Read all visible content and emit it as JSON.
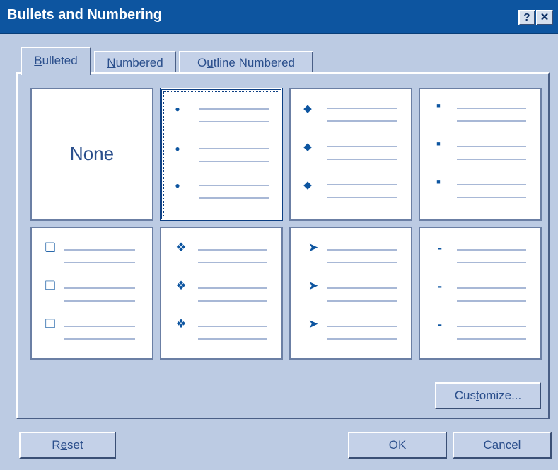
{
  "dialog": {
    "title": "Bullets and Numbering",
    "help_glyph": "?",
    "close_glyph": "✕"
  },
  "tabs": [
    {
      "label": "Bulleted",
      "accesskey": "B",
      "rest": "ulleted",
      "active": true
    },
    {
      "label": "Numbered",
      "accesskey": "N",
      "rest": "umbered",
      "active": false
    },
    {
      "label": "Outline Numbered",
      "pre": "O",
      "accesskey": "u",
      "rest": "tline Numbered",
      "active": false
    }
  ],
  "gallery": {
    "none_label": "None",
    "styles": [
      {
        "icon": "none"
      },
      {
        "icon": "round-bullet-icon",
        "glyph": "●",
        "selected": true
      },
      {
        "icon": "diamond-bullet-icon",
        "glyph": "◆"
      },
      {
        "icon": "square-bullet-icon",
        "glyph": "■"
      },
      {
        "icon": "hollow-square-bullet-icon",
        "glyph": "❑"
      },
      {
        "icon": "four-diamond-bullet-icon",
        "glyph": "❖"
      },
      {
        "icon": "arrowhead-bullet-icon",
        "glyph": "➤"
      },
      {
        "icon": "dash-bullet-icon",
        "glyph": "-"
      }
    ]
  },
  "buttons": {
    "customize": {
      "pre": "Cus",
      "accesskey": "t",
      "rest": "omize..."
    },
    "reset": {
      "pre": "R",
      "accesskey": "e",
      "rest": "set"
    },
    "ok": "OK",
    "cancel": "Cancel"
  },
  "colors": {
    "accent": "#0d55a0",
    "dialog_bg": "#bccbe3",
    "text": "#2b4f8c"
  }
}
